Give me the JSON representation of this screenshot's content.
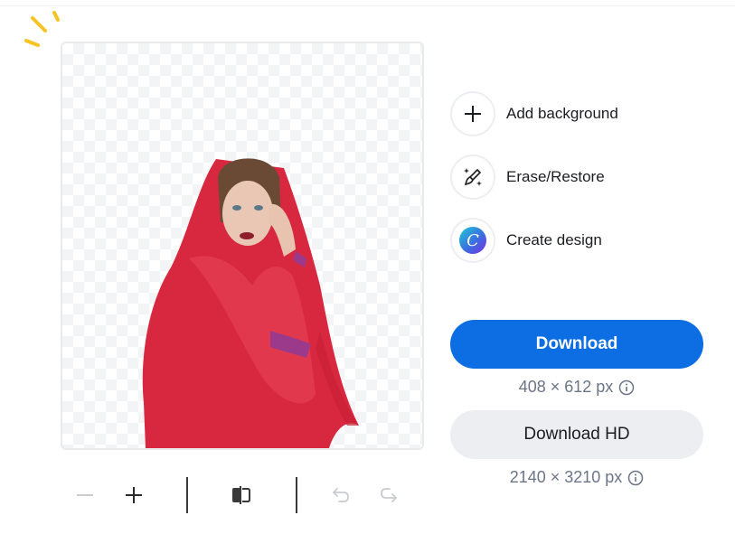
{
  "actions": [
    {
      "id": "add-background",
      "label": "Add background",
      "icon": "plus-icon"
    },
    {
      "id": "erase-restore",
      "label": "Erase/Restore",
      "icon": "magic-brush-icon"
    },
    {
      "id": "create-design",
      "label": "Create design",
      "icon": "canva-logo-icon"
    }
  ],
  "download": {
    "label": "Download",
    "size": "408 × 612 px",
    "color": "#0d6de3"
  },
  "download_hd": {
    "label": "Download HD",
    "size": "2140 × 3210 px"
  },
  "toolbar": {
    "zoom_out": "minus-icon",
    "zoom_in": "plus-icon",
    "compare": "compare-icon",
    "undo": "undo-icon",
    "redo": "redo-icon"
  },
  "image": {
    "subject": "woman in red scarf, background removed",
    "background": "transparent checkerboard"
  }
}
